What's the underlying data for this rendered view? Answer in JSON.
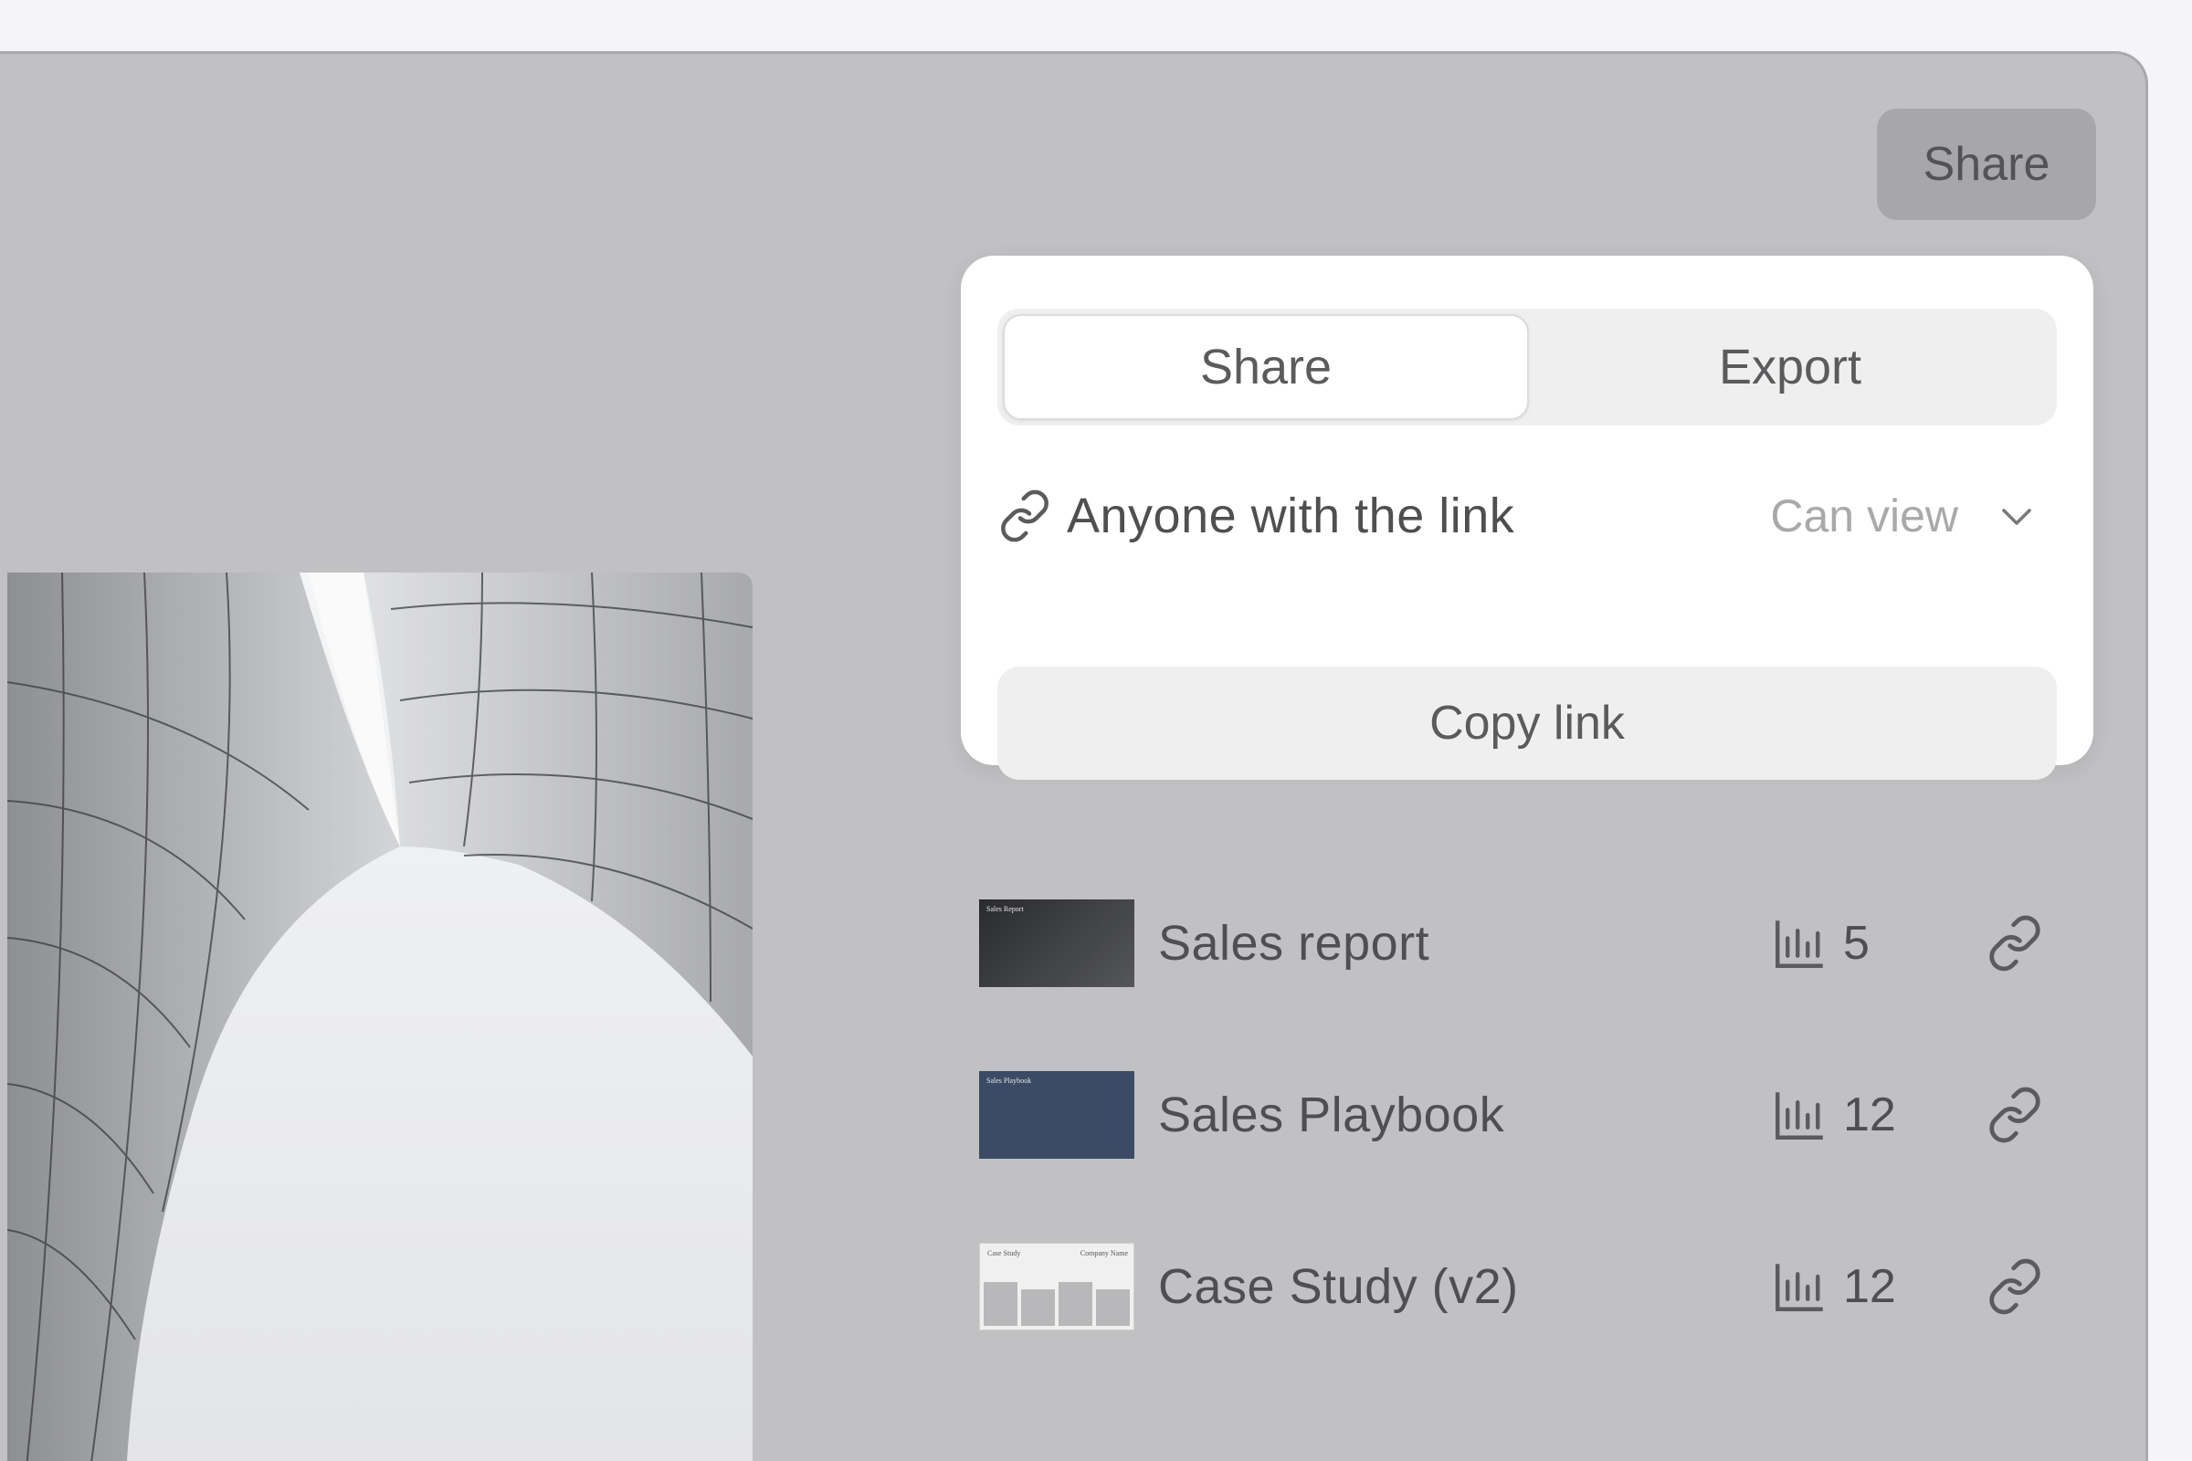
{
  "header": {
    "share_label": "Share"
  },
  "share_panel": {
    "tabs": [
      {
        "label": "Share",
        "active": true
      },
      {
        "label": "Export",
        "active": false
      }
    ],
    "access": {
      "label": "Anyone with the link",
      "permission": "Can view"
    },
    "copy_label": "Copy link"
  },
  "documents": [
    {
      "name": "Sales report",
      "views": "5",
      "thumb_title": "Sales Report",
      "thumb_color": "#2f3033"
    },
    {
      "name": "Sales Playbook",
      "views": "12",
      "thumb_title": "Sales Playbook",
      "thumb_color": "#3b4b66"
    },
    {
      "name": "Case Study (v2)",
      "views": "12",
      "thumb_title": "Case Study",
      "thumb_subtitle": "Company Name",
      "thumb_color": "#f0f0f0"
    }
  ],
  "colors": {
    "window_bg": "#c1c1c3",
    "panel_bg": "#ffffff",
    "text": "#4f4f52",
    "muted": "#a9a9ac"
  }
}
